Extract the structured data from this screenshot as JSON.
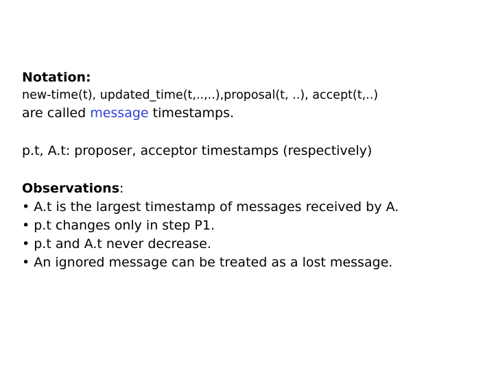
{
  "notation": {
    "heading": "Notation:",
    "line1": "new-time(t), updated_time(t,..,..),proposal(t, ..), accept(t,..)",
    "line2_prefix": "are called ",
    "line2_highlight": "message",
    "line2_suffix": " timestamps."
  },
  "timestamps_line": "p.t, A.t: proposer, acceptor timestamps (respectively)",
  "observations": {
    "heading": "Observations",
    "heading_colon": ":",
    "items": [
      "• A.t is the largest timestamp of messages received by A.",
      "• p.t changes only in step P1.",
      "• p.t and A.t never decrease.",
      "• An ignored message can be treated as a lost message."
    ]
  },
  "colors": {
    "highlight": "#2b3fd6",
    "text": "#000000",
    "background": "#ffffff"
  }
}
